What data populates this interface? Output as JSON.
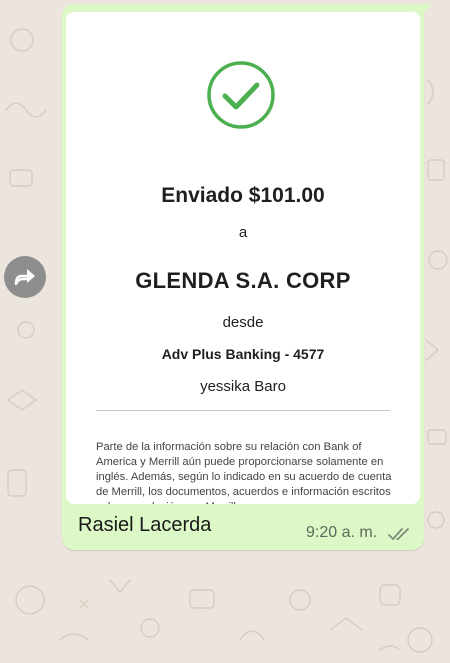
{
  "receipt": {
    "amount_text": "Enviado $101.00",
    "connector_to": "a",
    "recipient": "GLENDA S.A. CORP",
    "connector_from": "desde",
    "account": "Adv Plus Banking - 4577",
    "sender_name": "yessika Baro",
    "disclaimer": "Parte de la información sobre su relación con Bank of America y Merrill aún puede proporcionarse solamente en inglés. Además, según lo indicado en su acuerdo de cuenta de Merrill, los documentos, acuerdos e información escritos sobre su relación con Merrill, que"
  },
  "message": {
    "caption": "Rasiel Lacerda",
    "time": "9:20 a. m."
  },
  "icons": {
    "success": "check-circle-icon",
    "forward": "forward-icon",
    "status": "double-check-icon"
  },
  "colors": {
    "bubble": "#dcf8c6",
    "check": "#4caf50",
    "wallpaper": "#ece5dd",
    "forward_button": "#8e8e8e"
  }
}
